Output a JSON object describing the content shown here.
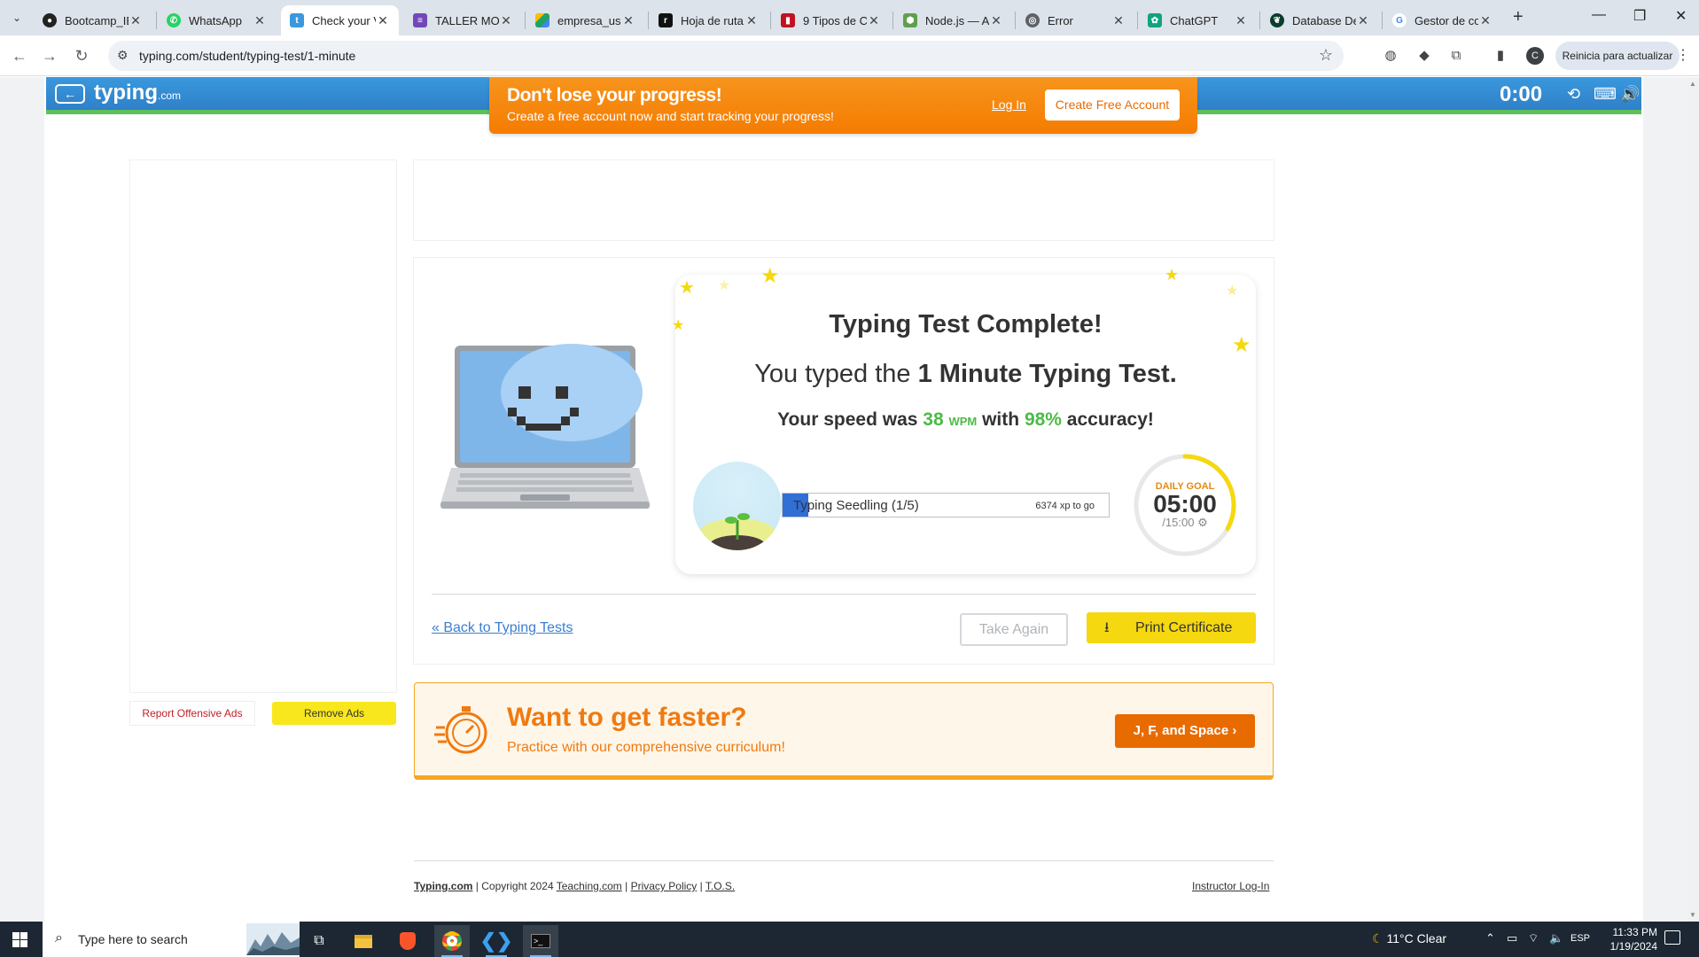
{
  "browser": {
    "tabs": [
      {
        "label": "Bootcamp_IE",
        "icon": "github-icon",
        "color": "#222222"
      },
      {
        "label": "WhatsApp",
        "icon": "whatsapp-icon",
        "color": "#25d366"
      },
      {
        "label": "Check your V",
        "icon": "typing-icon",
        "color": "#3a98dd",
        "active": true
      },
      {
        "label": "TALLER MON",
        "icon": "forms-icon",
        "color": "#7248b9"
      },
      {
        "label": "empresa_usu",
        "icon": "drive-icon",
        "color": "#1fa463"
      },
      {
        "label": "Hoja de ruta",
        "icon": "roadmap-icon",
        "color": "#111111"
      },
      {
        "label": "9 Tipos de C",
        "icon": "site-icon",
        "color": "#c1121f"
      },
      {
        "label": "Node.js — A",
        "icon": "nodejs-icon",
        "color": "#5fa04e"
      },
      {
        "label": "Error",
        "icon": "globe-icon",
        "color": "#5f6368"
      },
      {
        "label": "ChatGPT",
        "icon": "chatgpt-icon",
        "color": "#10a37f"
      },
      {
        "label": "Database De",
        "icon": "mongodb-icon",
        "color": "#0b3d2e"
      },
      {
        "label": "Gestor de co",
        "icon": "google-icon",
        "color": "#4285f4"
      }
    ],
    "url": "typing.com/student/typing-test/1-minute",
    "update_button": "Reinicia para actualizar",
    "profile_initial": "C"
  },
  "header": {
    "logo": "typing",
    "logo_suffix": ".com",
    "timer": "0:00"
  },
  "promo": {
    "title": "Don't lose your progress!",
    "subtitle": "Create a free account now and start tracking your progress!",
    "login": "Log In",
    "create": "Create Free Account"
  },
  "ads": {
    "report": "Report Offensive Ads",
    "remove": "Remove Ads"
  },
  "result": {
    "title": "Typing Test Complete!",
    "typed_prefix": "You typed the ",
    "test_name": "1 Minute Typing Test.",
    "speed_prefix": "Your speed was ",
    "wpm_value": "38",
    "wpm_unit": "WPM",
    "speed_mid": " with ",
    "accuracy": "98%",
    "speed_suffix": " accuracy!",
    "level_label": "Typing Seedling (1/5)",
    "xp_to_go": "6374 xp to go",
    "xp_progress": 0.08,
    "goal_label": "DAILY GOAL",
    "goal_time": "05:00",
    "goal_total": "/15:00",
    "goal_progress": 0.33
  },
  "actions": {
    "back": "« Back to Typing Tests",
    "again": "Take Again",
    "print": "Print Certificate"
  },
  "faster": {
    "title": "Want to get faster?",
    "subtitle": "Practice with our comprehensive curriculum!",
    "button": "J, F, and Space ›"
  },
  "footer": {
    "brand": "Typing.com",
    "copyright": " | Copyright 2024 ",
    "teaching": "Teaching.com",
    "privacy": "Privacy Policy",
    "tos": "T.O.S.",
    "sep": " | ",
    "instructor": "Instructor Log-In"
  },
  "taskbar": {
    "search_placeholder": "Type here to search",
    "weather": "11°C  Clear",
    "lang": "ESP",
    "time": "11:33 PM",
    "date": "1/19/2024"
  }
}
